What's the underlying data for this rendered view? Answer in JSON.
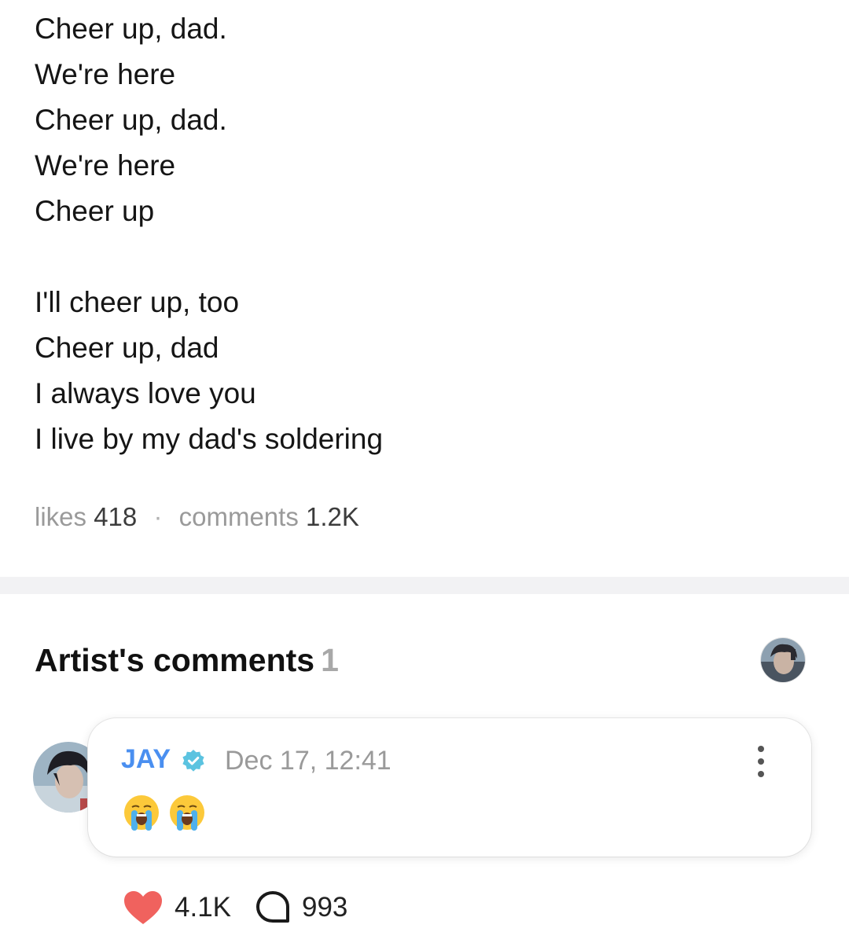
{
  "post": {
    "lines": [
      "Cheer up, dad.",
      "We're here",
      "Cheer up, dad.",
      "We're here",
      "Cheer up",
      "",
      "I'll cheer up, too",
      "Cheer up, dad",
      "I always love you",
      "I live by my dad's soldering"
    ],
    "likes_label": "likes",
    "likes_value": "418",
    "separator": "·",
    "comments_label": "comments",
    "comments_value": "1.2K"
  },
  "artist_comments": {
    "title": "Artist's comments",
    "count": "1",
    "header_avatar_icon": "artist-avatar",
    "comment": {
      "author": "JAY",
      "verified_icon": "verified-badge-icon",
      "timestamp": "Dec 17, 12:41",
      "body_emoji": [
        "loudly-crying-face",
        "loudly-crying-face"
      ],
      "more_icon": "more-vertical-icon",
      "likes": "4.1K",
      "replies": "993"
    }
  },
  "colors": {
    "author": "#4a8ff0",
    "verified": "#5bc3e0",
    "heart": "#f0625e",
    "muted": "#9a9a9a",
    "divider": "#f2f2f4"
  }
}
